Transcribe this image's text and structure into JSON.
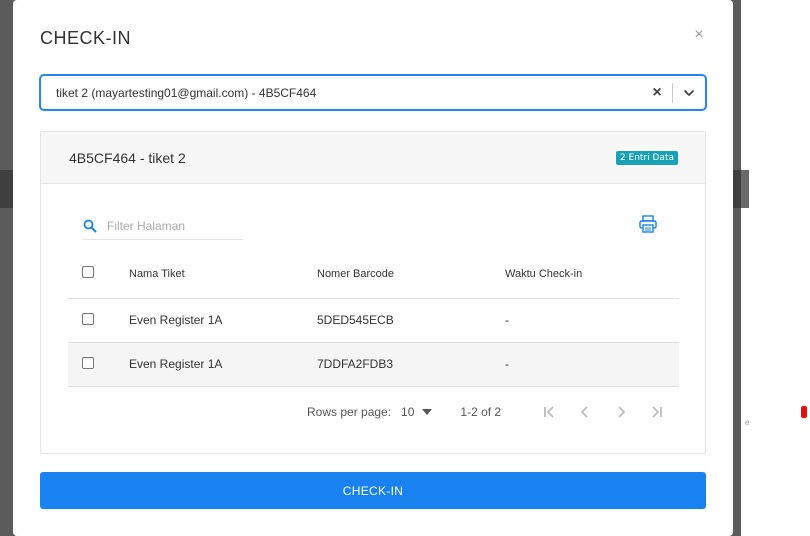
{
  "backdrop": {
    "side_text": "e"
  },
  "modal": {
    "title": "CHECK-IN",
    "close_label": "×"
  },
  "ticket_select": {
    "value": "tiket 2 (mayartesting01@gmail.com) - 4B5CF464",
    "clear_label": "×"
  },
  "card": {
    "title": "4B5CF464 - tiket 2",
    "badge": "2 Entri Data"
  },
  "search": {
    "placeholder": "Filter Halaman"
  },
  "table": {
    "columns": [
      "Nama Tiket",
      "Nomer Barcode",
      "Waktu Check-in"
    ],
    "rows": [
      {
        "name": "Even Register 1A",
        "barcode": "5DED545ECB",
        "checkin_time": "-"
      },
      {
        "name": "Even Register 1A",
        "barcode": "7DDFA2FDB3",
        "checkin_time": "-"
      }
    ]
  },
  "pagination": {
    "rows_per_page_label": "Rows per page:",
    "rows_per_page_value": "10",
    "range": "1-2 of 2"
  },
  "checkin_button": {
    "label": "CHECK-IN"
  },
  "colors": {
    "accent": "#1a82f0",
    "badge": "#17a2b8",
    "focus_border": "#2684ff"
  }
}
